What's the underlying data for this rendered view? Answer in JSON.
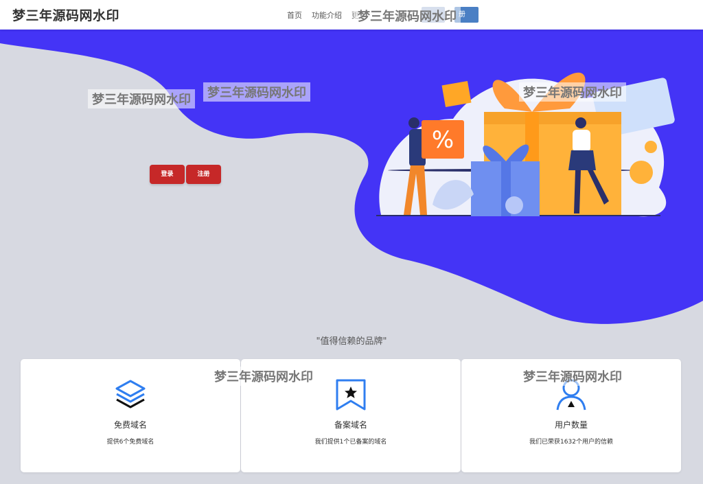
{
  "header": {
    "logo": "梦三年源码网水印",
    "nav": [
      "首页",
      "功能介绍",
      "更"
    ],
    "login_label": "",
    "register_label": "册"
  },
  "watermark": "梦三年源码网水印",
  "hero": {
    "login_label": "登录",
    "register_label": "注册"
  },
  "section_title": "\"值得信赖的品牌\"",
  "features": [
    {
      "title": "免费域名",
      "desc": "提供6个免费域名",
      "icon": "layers-icon"
    },
    {
      "title": "备案域名",
      "desc": "我们提供1个已备案的域名",
      "icon": "bookmark-star-icon"
    },
    {
      "title": "用户数量",
      "desc": "我们已荣获1632个用户的信赖",
      "icon": "user-icon"
    }
  ],
  "colors": {
    "accent": "#4434f6",
    "button": "#c62828",
    "background": "#d7d9e1"
  }
}
